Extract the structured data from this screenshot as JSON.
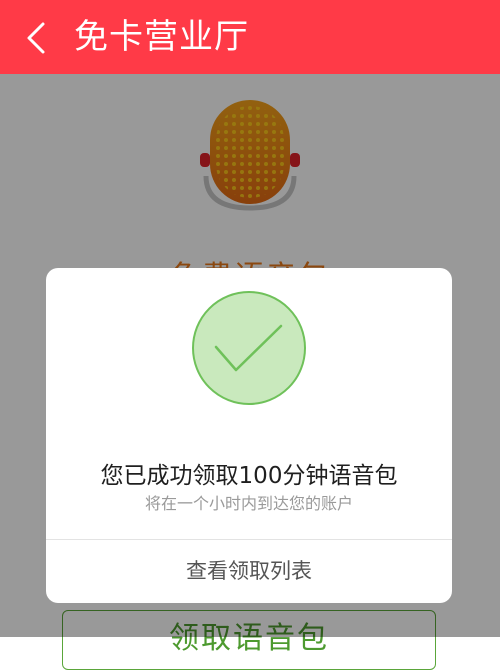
{
  "header": {
    "title": "免卡营业厅"
  },
  "page": {
    "heading": "免费语音包",
    "claim_button_label": "领取语音包"
  },
  "dialog": {
    "title": "您已成功领取100分钟语音包",
    "subtitle": "将在一个小时内到达您的账户",
    "action_label": "查看领取列表"
  },
  "colors": {
    "header_bg": "#ff3a47",
    "accent_orange": "#e8791b",
    "success_green": "#6fc15a",
    "button_green": "#5aa63a"
  },
  "icons": {
    "back": "chevron-left-icon",
    "microphone": "microphone-icon",
    "success": "check-circle-icon"
  }
}
